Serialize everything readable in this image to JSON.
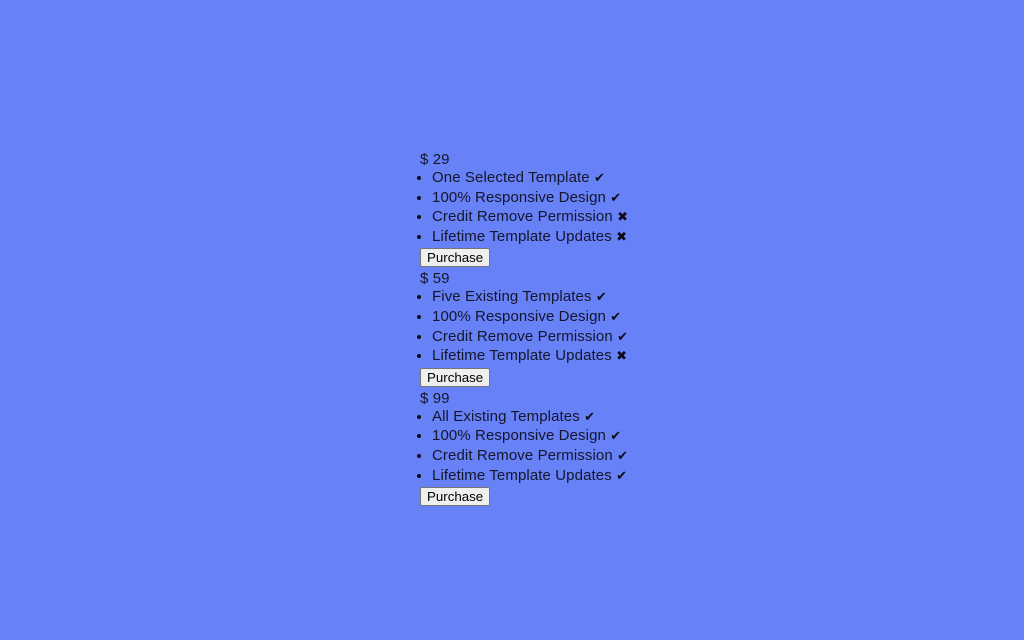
{
  "page": {
    "background_color": "#6781f7",
    "text_color": "#15152b",
    "mark_color": "#0b0b18"
  },
  "marks": {
    "included": "✔",
    "excluded": "✖"
  },
  "plans": [
    {
      "price": "$ 29",
      "features": [
        {
          "label": "One Selected Template",
          "mark": "✔",
          "included": true
        },
        {
          "label": "100% Responsive Design",
          "mark": "✔",
          "included": true
        },
        {
          "label": "Credit Remove Permission",
          "mark": "✖",
          "included": false
        },
        {
          "label": "Lifetime Template Updates",
          "mark": "✖",
          "included": false
        }
      ],
      "cta_label": "Purchase"
    },
    {
      "price": "$ 59",
      "features": [
        {
          "label": "Five Existing Templates",
          "mark": "✔",
          "included": true
        },
        {
          "label": "100% Responsive Design",
          "mark": "✔",
          "included": true
        },
        {
          "label": "Credit Remove Permission",
          "mark": "✔",
          "included": true
        },
        {
          "label": "Lifetime Template Updates",
          "mark": "✖",
          "included": false
        }
      ],
      "cta_label": "Purchase"
    },
    {
      "price": "$ 99",
      "features": [
        {
          "label": "All Existing Templates",
          "mark": "✔",
          "included": true
        },
        {
          "label": "100% Responsive Design",
          "mark": "✔",
          "included": true
        },
        {
          "label": "Credit Remove Permission",
          "mark": "✔",
          "included": true
        },
        {
          "label": "Lifetime Template Updates",
          "mark": "✔",
          "included": true
        }
      ],
      "cta_label": "Purchase"
    }
  ]
}
